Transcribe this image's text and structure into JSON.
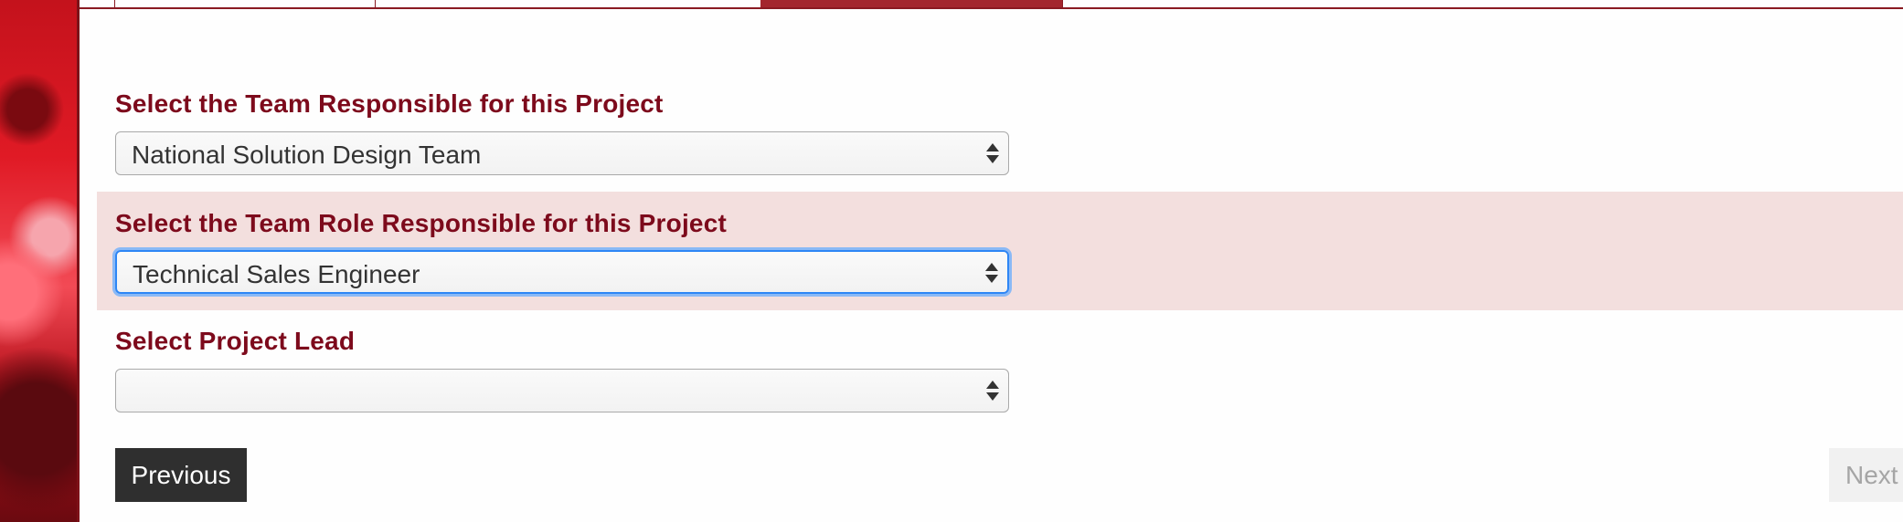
{
  "form": {
    "team": {
      "label": "Select the Team Responsible for this Project",
      "selected": "National Solution Design Team"
    },
    "team_role": {
      "label": "Select the Team Role Responsible for this Project",
      "selected": "Technical Sales Engineer"
    },
    "project_lead": {
      "label": "Select Project Lead",
      "selected": ""
    }
  },
  "buttons": {
    "previous": "Previous",
    "next": "Next"
  },
  "theme": {
    "label_color": "#7d0a1c",
    "active_tab_color": "#a3262e",
    "highlight_row": "#f3dfde",
    "focus_ring": "#2e86f5"
  }
}
